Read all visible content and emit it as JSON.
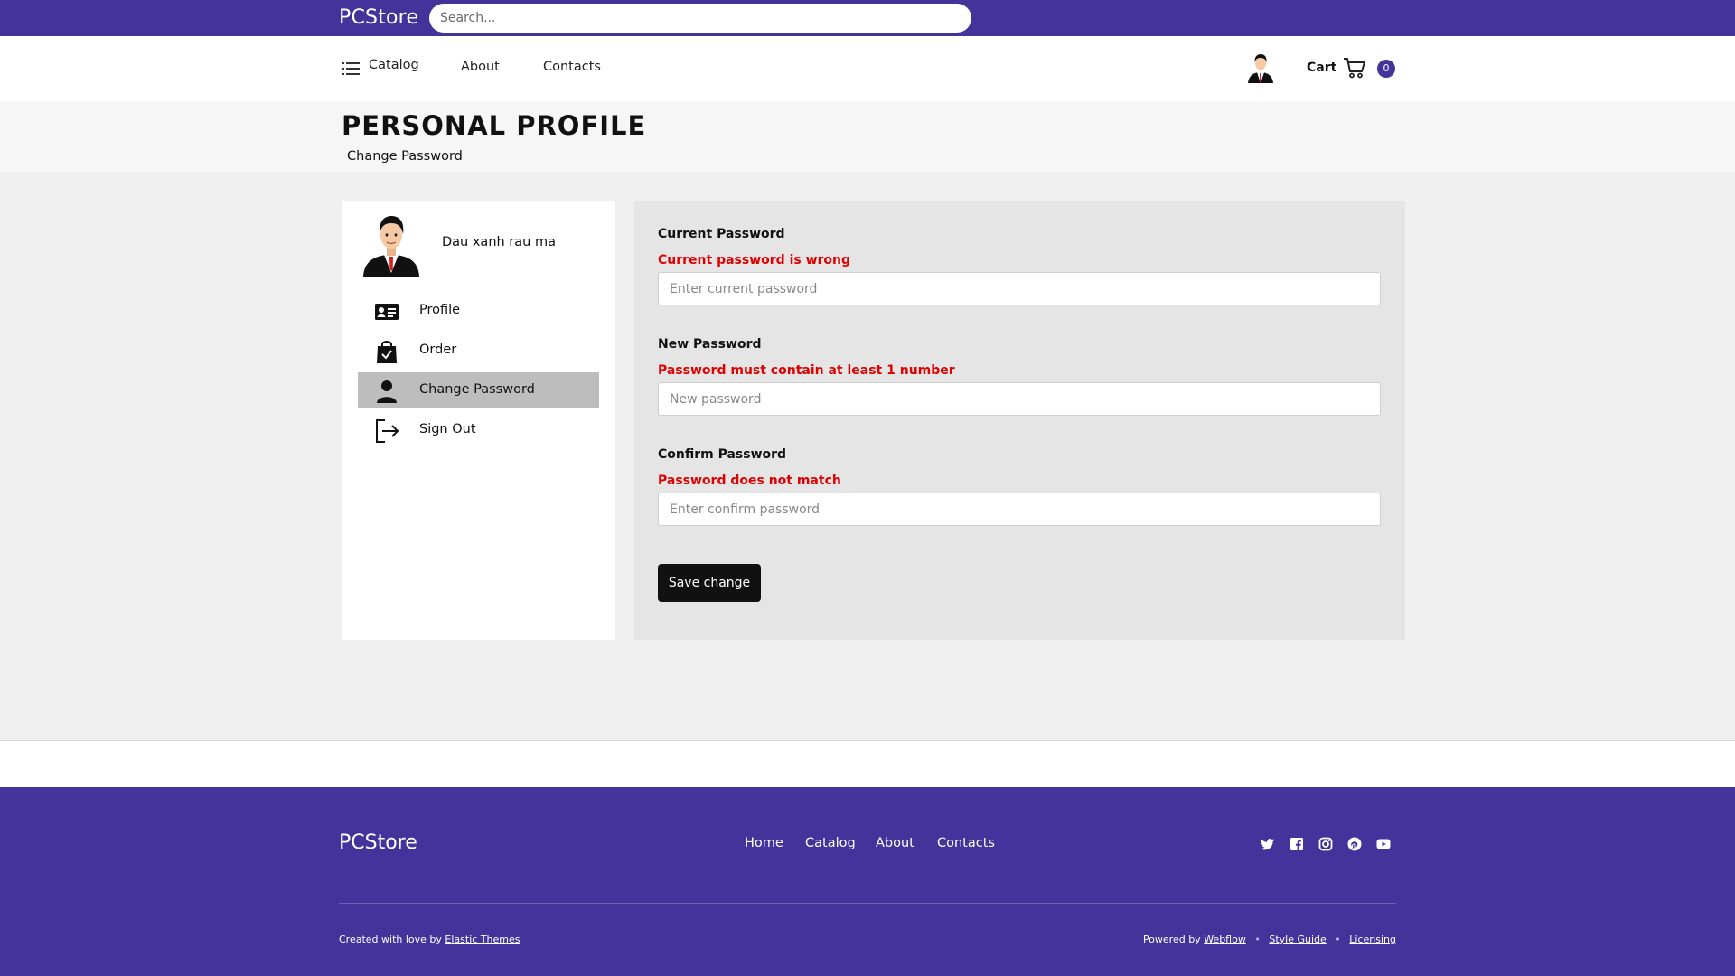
{
  "topbar": {
    "brand": "PCStore",
    "search_placeholder": "Search..."
  },
  "navbar": {
    "catalog": "Catalog",
    "about": "About",
    "contacts": "Contacts",
    "cart_label": "Cart",
    "cart_count": "0"
  },
  "header": {
    "title": "PERSONAL PROFILE",
    "breadcrumb": "Change Password"
  },
  "sidebar": {
    "username": "Dau xanh rau ma",
    "items": [
      {
        "label": "Profile",
        "icon": "id-card-icon"
      },
      {
        "label": "Order",
        "icon": "shopping-bag-icon"
      },
      {
        "label": "Change Password",
        "icon": "user-icon",
        "active": true
      },
      {
        "label": "Sign Out",
        "icon": "sign-out-icon"
      }
    ]
  },
  "form": {
    "current": {
      "label": "Current Password",
      "error": "Current password is wrong",
      "placeholder": "Enter current password"
    },
    "new": {
      "label": "New Password",
      "error": "Password must contain at least 1 number",
      "placeholder": "New password"
    },
    "confirm": {
      "label": "Confirm Password",
      "error": "Password does not match",
      "placeholder": "Enter confirm password"
    },
    "save_label": "Save change"
  },
  "footer": {
    "brand": "PCStore",
    "links": [
      "Home",
      "Catalog",
      "About",
      "Contacts"
    ],
    "social_icons": [
      "twitter-icon",
      "facebook-icon",
      "instagram-icon",
      "pinterest-icon",
      "youtube-icon"
    ],
    "credit_prefix": "Created with love by",
    "credit_link": "Elastic Themes",
    "powered_prefix": "Powered by",
    "powered_link": "Webflow",
    "style_guide": "Style Guide",
    "licensing": "Licensing"
  },
  "colors": {
    "brand": "#45339c",
    "error": "#e00000",
    "active_item": "#bdbdbd"
  }
}
